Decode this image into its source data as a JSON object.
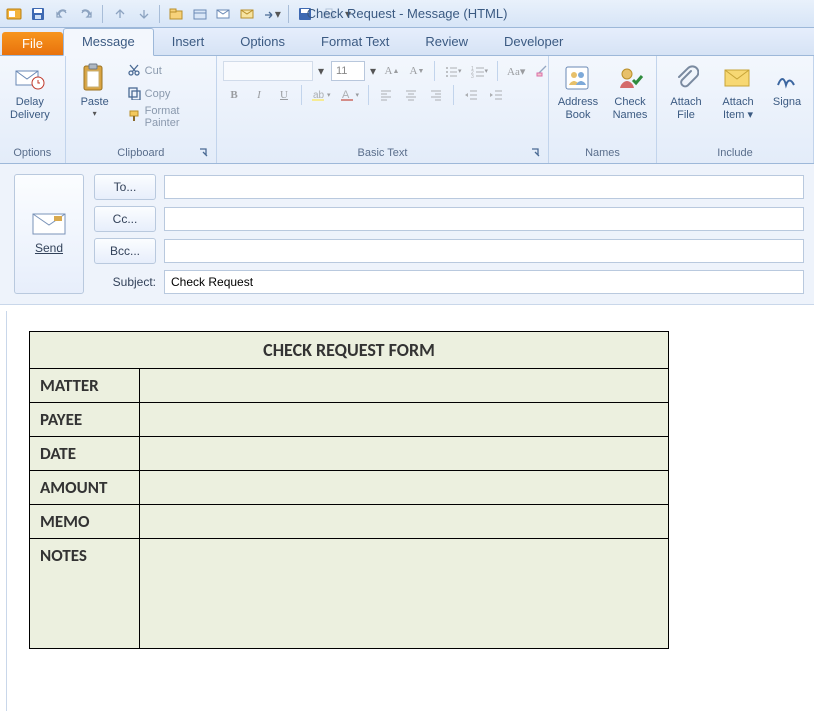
{
  "window": {
    "title": "Check Request - Message (HTML)"
  },
  "qat": {
    "items": [
      "outlook-icon",
      "save-icon",
      "undo-icon",
      "redo-icon",
      "prev-icon",
      "next-icon",
      "move-icon",
      "mailbox-icon",
      "envelope-icon",
      "reply-icon",
      "replyall-icon",
      "save2-icon",
      "print-icon"
    ]
  },
  "tabs": {
    "file": "File",
    "items": [
      "Message",
      "Insert",
      "Options",
      "Format Text",
      "Review",
      "Developer"
    ],
    "active": "Message"
  },
  "ribbon": {
    "options": {
      "label": "Options",
      "delay": "Delay\nDelivery"
    },
    "clipboard": {
      "label": "Clipboard",
      "paste": "Paste",
      "cut": "Cut",
      "copy": "Copy",
      "fmt": "Format Painter"
    },
    "basicText": {
      "label": "Basic Text",
      "fontSize": "11",
      "bold": "B",
      "italic": "I",
      "underline": "U"
    },
    "names": {
      "label": "Names",
      "addr": "Address\nBook",
      "check": "Check\nNames"
    },
    "include": {
      "label": "Include",
      "attachFile": "Attach\nFile",
      "attachItem": "Attach\nItem ▾",
      "sign": "Signa"
    }
  },
  "compose": {
    "send": "Send",
    "to": "To...",
    "cc": "Cc...",
    "bcc": "Bcc...",
    "subjectLabel": "Subject:",
    "subjectValue": "Check Request"
  },
  "body": {
    "formTitle": "CHECK REQUEST FORM",
    "rows": [
      {
        "label": "MATTER",
        "value": ""
      },
      {
        "label": "PAYEE",
        "value": ""
      },
      {
        "label": "DATE",
        "value": ""
      },
      {
        "label": "AMOUNT",
        "value": ""
      },
      {
        "label": "MEMO",
        "value": ""
      },
      {
        "label": "NOTES",
        "value": "",
        "tall": true
      }
    ]
  }
}
